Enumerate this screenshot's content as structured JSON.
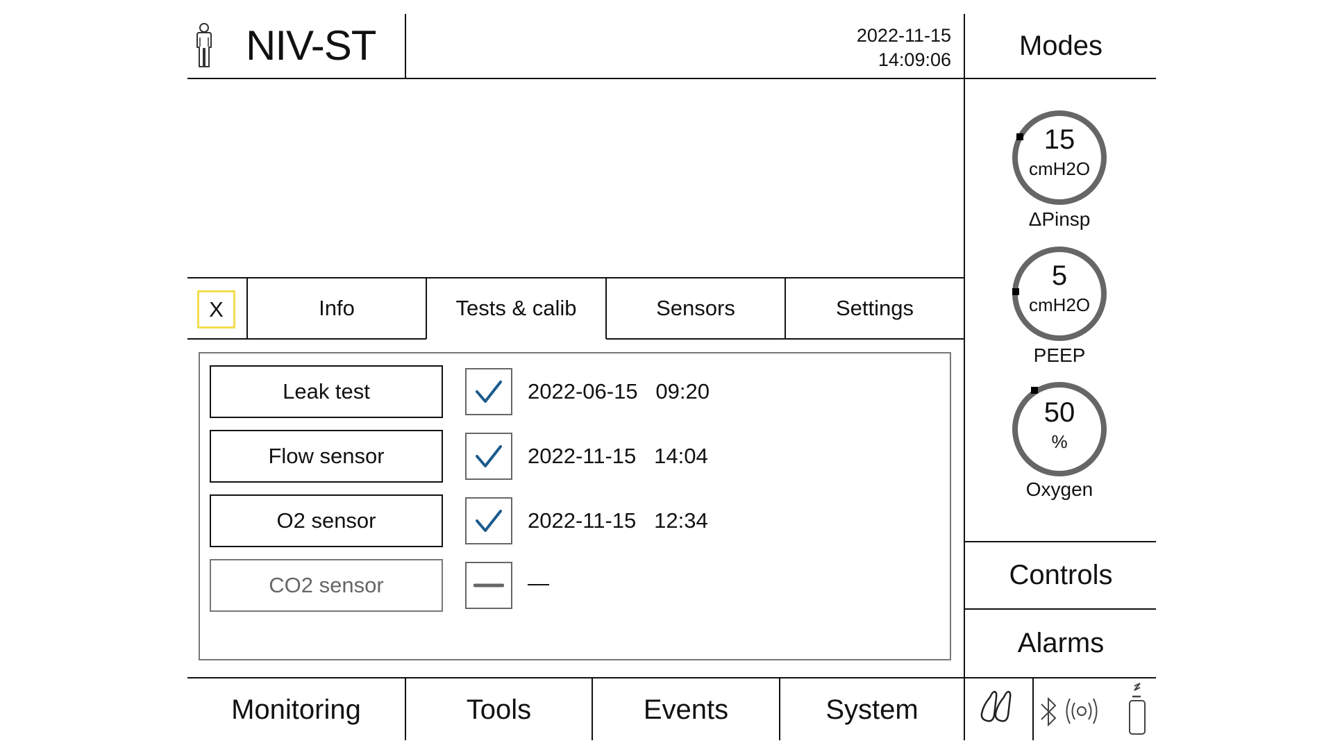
{
  "header": {
    "patient_icon": "person-icon",
    "mode": "NIV-ST",
    "date": "2022-11-15",
    "time": "14:09:06",
    "modes_label": "Modes"
  },
  "dials": [
    {
      "name": "delta-pinsp",
      "value": "15",
      "unit": "cmH2O",
      "label": "ΔPinsp"
    },
    {
      "name": "peep",
      "value": "5",
      "unit": "cmH2O",
      "label": "PEEP"
    },
    {
      "name": "oxygen",
      "value": "50",
      "unit": "%",
      "label": "Oxygen"
    }
  ],
  "side": {
    "controls_label": "Controls",
    "alarms_label": "Alarms"
  },
  "panel": {
    "close_label": "X",
    "close_highlight_color": "#f3dd52",
    "tabs": [
      {
        "label": "Info",
        "active": false
      },
      {
        "label": "Tests & calib",
        "active": true
      },
      {
        "label": "Sensors",
        "active": false
      },
      {
        "label": "Settings",
        "active": false
      }
    ],
    "tests": [
      {
        "label": "Leak test",
        "status": "passed",
        "stamp": "2022-06-15   09:20",
        "enabled": true
      },
      {
        "label": "Flow sensor",
        "status": "passed",
        "stamp": "2022-11-15   14:04",
        "enabled": true
      },
      {
        "label": "O2 sensor",
        "status": "passed",
        "stamp": "2022-11-15   12:34",
        "enabled": true
      },
      {
        "label": "CO2 sensor",
        "status": "not-available",
        "stamp": "—",
        "enabled": false
      }
    ],
    "check_color": "#1b5a8c"
  },
  "nav": {
    "items": [
      "Monitoring",
      "Tools",
      "Events",
      "System"
    ]
  },
  "status_icons": [
    "lungs-icon",
    "bluetooth-icon",
    "wireless-icon",
    "battery-charging-icon"
  ]
}
